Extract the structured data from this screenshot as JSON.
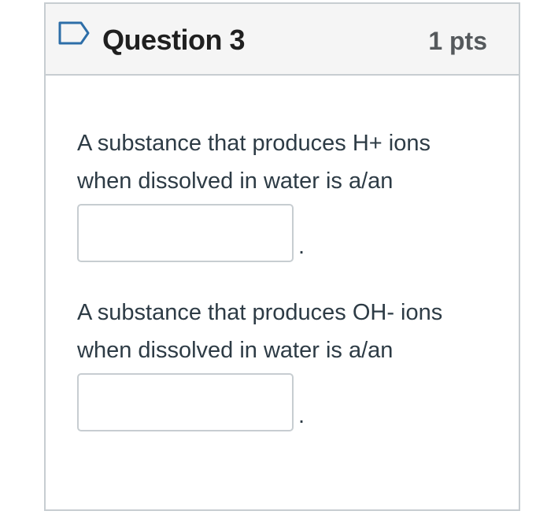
{
  "question": {
    "flag_icon": "bookmark-flag-icon",
    "title": "Question 3",
    "points": "1 pts"
  },
  "prompts": [
    {
      "line1": "A substance that produces H+ ions",
      "line2": "when dissolved in water is a/an",
      "input_value": "",
      "suffix": "."
    },
    {
      "line1": "A substance that produces OH- ions",
      "line2": "when dissolved in water is a/an",
      "input_value": "",
      "suffix": "."
    }
  ],
  "colors": {
    "header_bg": "#f5f5f5",
    "border": "#c7cdd1",
    "text": "#2d3b45",
    "flag_icon": "#2d6ea8"
  }
}
